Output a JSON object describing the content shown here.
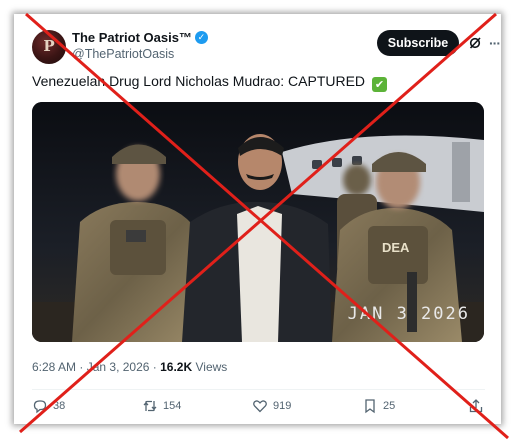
{
  "account": {
    "display_name": "The Patriot Oasis™",
    "handle": "@ThePatriotOasis",
    "avatar_monogram": "P",
    "verified": true
  },
  "header": {
    "subscribe_label": "Subscribe",
    "grok_icon": "grok-icon",
    "more_icon": "more-icon"
  },
  "post": {
    "text": "Venezuelan Drug Lord Nicholas Mudrao: CAPTURED",
    "emoji": "✔",
    "media": {
      "date_stamp": "JAN 3 2026",
      "vest_label": "DEA"
    },
    "time": "6:28 AM",
    "separator": "·",
    "date": "Jan 3, 2026",
    "views_count": "16.2K",
    "views_label": "Views"
  },
  "actions": {
    "replies": "38",
    "reposts": "154",
    "likes": "919",
    "bookmarks": "25"
  },
  "colors": {
    "accent_blue": "#1d9bf0",
    "text_primary": "#0f1419",
    "text_secondary": "#536471",
    "cross_red": "#e0201a",
    "check_green": "#5cb338"
  }
}
